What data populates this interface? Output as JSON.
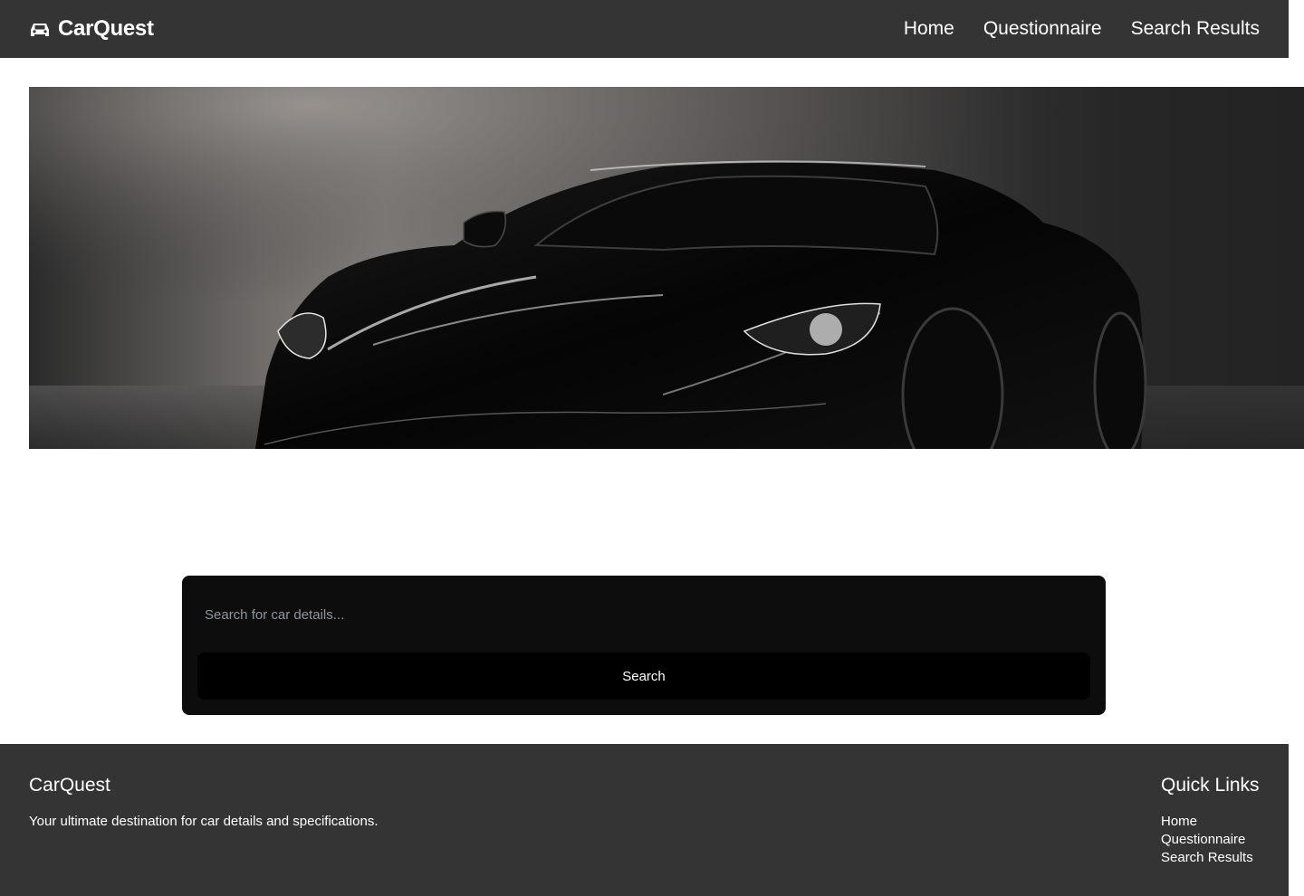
{
  "header": {
    "brand": "CarQuest",
    "brand_icon": "car-icon",
    "nav": [
      "Home",
      "Questionnaire",
      "Search Results"
    ]
  },
  "hero": {
    "image": "black-sports-car"
  },
  "search": {
    "placeholder": "Search for car details...",
    "button_label": "Search"
  },
  "footer": {
    "title": "CarQuest",
    "description": "Your ultimate destination for car details and specifications.",
    "quick_links_title": "Quick Links",
    "quick_links": [
      "Home",
      "Questionnaire",
      "Search Results"
    ]
  },
  "colors": {
    "header_bg": "#343434",
    "footer_bg": "#343434",
    "panel_bg": "#0d0d0d",
    "button_bg": "#000000",
    "text": "#ffffff",
    "placeholder": "#8e95a3"
  }
}
